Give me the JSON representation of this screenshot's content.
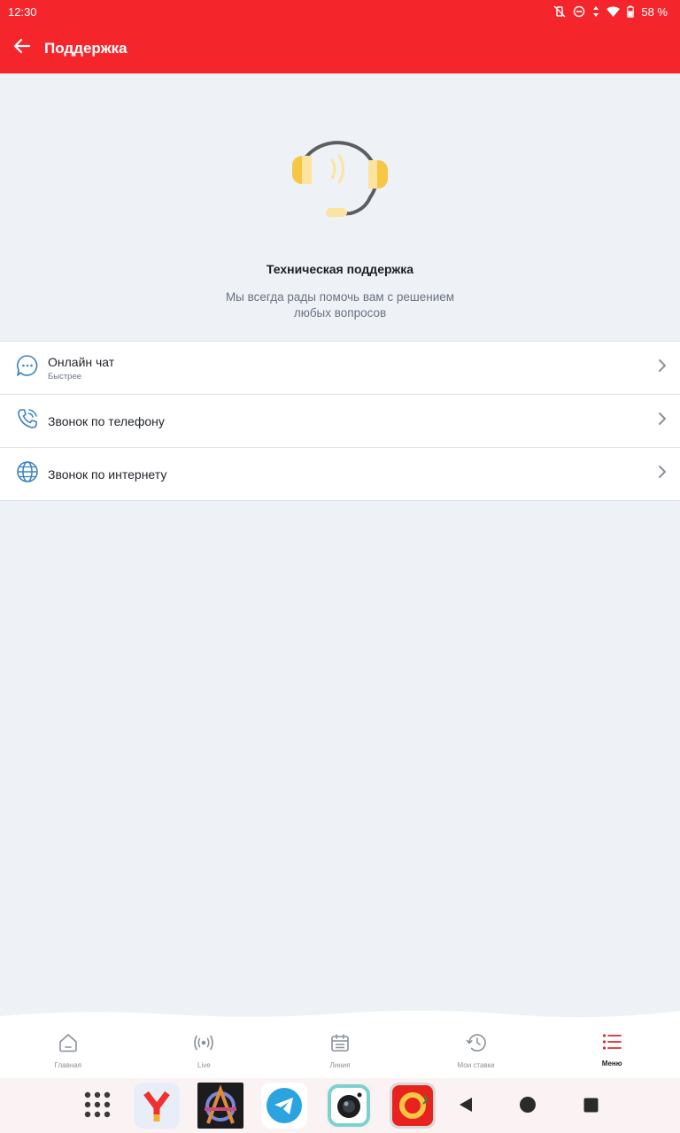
{
  "status_bar": {
    "time": "12:30",
    "battery": "58 %"
  },
  "app_bar": {
    "title": "Поддержка"
  },
  "hero": {
    "title": "Техническая поддержка",
    "subtitle": "Мы всегда рады помочь вам с решением любых вопросов"
  },
  "support_options": [
    {
      "title": "Онлайн чат",
      "subtitle": "Быстрее",
      "icon": "chat-icon"
    },
    {
      "title": "Звонок по телефону",
      "icon": "phone-icon"
    },
    {
      "title": "Звонок по интернету",
      "icon": "globe-icon"
    }
  ],
  "bottom_nav": {
    "items": [
      {
        "label": "Главная",
        "icon": "home-icon"
      },
      {
        "label": "Live",
        "icon": "broadcast-icon"
      },
      {
        "label": "Линия",
        "icon": "calendar-icon"
      },
      {
        "label": "Мои ставки",
        "icon": "history-icon"
      },
      {
        "label": "Меню",
        "icon": "menu-list-icon",
        "active": true
      }
    ]
  },
  "colors": {
    "brand": "#f5262b",
    "accent_blue": "#3b82c4",
    "headset_yellow": "#f6c744"
  }
}
